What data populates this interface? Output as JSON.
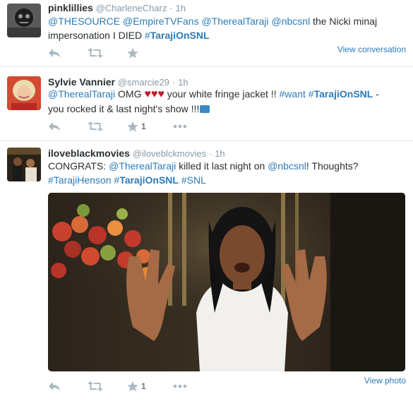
{
  "tweets": [
    {
      "name": "pinklillies",
      "handle": "@CharleneCharz",
      "dot": "·",
      "time": "1h",
      "line1_parts": [
        "@THESOURCE",
        " ",
        "@EmpireTVFans",
        " ",
        "@TherealTaraji",
        " ",
        "@nbcsnl",
        " the Nicki minaj"
      ],
      "line2_prefix": "impersonation I DIED ",
      "hashtag_hash": "#",
      "hashtag_bold": "TarajiOnSNL",
      "view_link": "View conversation",
      "favorite_count": ""
    },
    {
      "name": "Sylvie Vannier",
      "handle": "@smarcie29",
      "dot": "·",
      "time": "1h",
      "mention": "@TherealTaraji",
      "omg": " OMG ",
      "hearts": "♥♥♥",
      "jacket": " your white fringe jacket !! ",
      "tag_want": "#want",
      "tag_hash": " #",
      "tag_bold": "TarajiOnSNL",
      "dash": "  -",
      "line2": "you rocked it & last night's show !!!",
      "tv": "📺",
      "favorite_count": "1"
    },
    {
      "name": "iloveblackmovies",
      "handle": "@iloveblckmovies",
      "dot": "·",
      "time": "1h",
      "congrats": "CONGRATS: ",
      "mention1": "@TherealTaraji",
      "killed": " killed it last night on ",
      "mention2": "@nbcsnl",
      "thoughts": "! Thoughts?",
      "tag1": "#TarajiHenson",
      "tag2_hash": "#",
      "tag2_bold": "TarajiOnSNL",
      "tag3": "#SNL",
      "view_link": "View photo",
      "favorite_count": "1"
    }
  ],
  "icons": [
    "reply-icon",
    "retweet-icon",
    "favorite-icon",
    "more-icon"
  ],
  "colors": {
    "link": "#2b7bb9",
    "muted": "#8899a6",
    "icon": "#aab8c2",
    "heart": "#c0182a"
  }
}
